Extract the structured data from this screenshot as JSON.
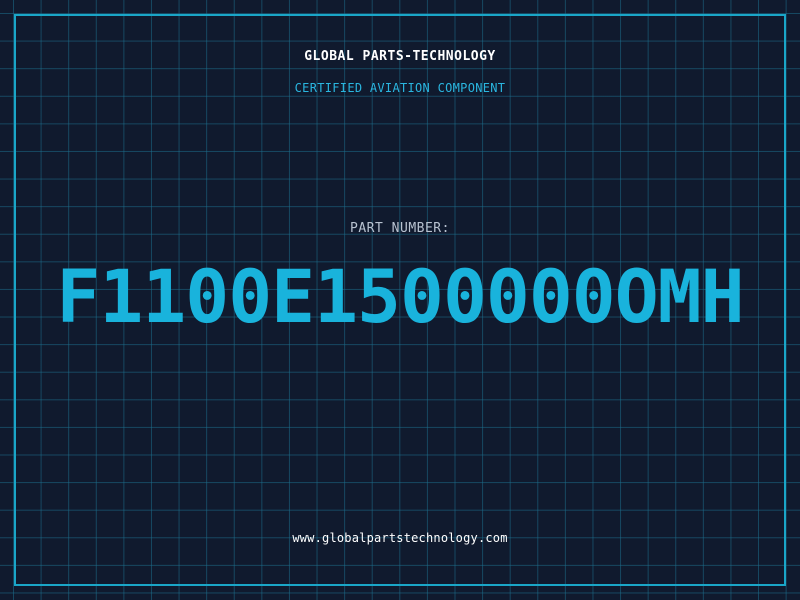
{
  "header": {
    "brand": "GLOBAL PARTS-TECHNOLOGY",
    "subtitle": "CERTIFIED AVIATION COMPONENT"
  },
  "part": {
    "label": "PART NUMBER:",
    "number": "F1100E1500000OMH"
  },
  "footer": {
    "website": "www.globalpartstechnology.com"
  },
  "colors": {
    "background": "#101a2e",
    "grid": "#1c6e8c",
    "frame": "#1aa6c8",
    "accent": "#19b3dc"
  }
}
